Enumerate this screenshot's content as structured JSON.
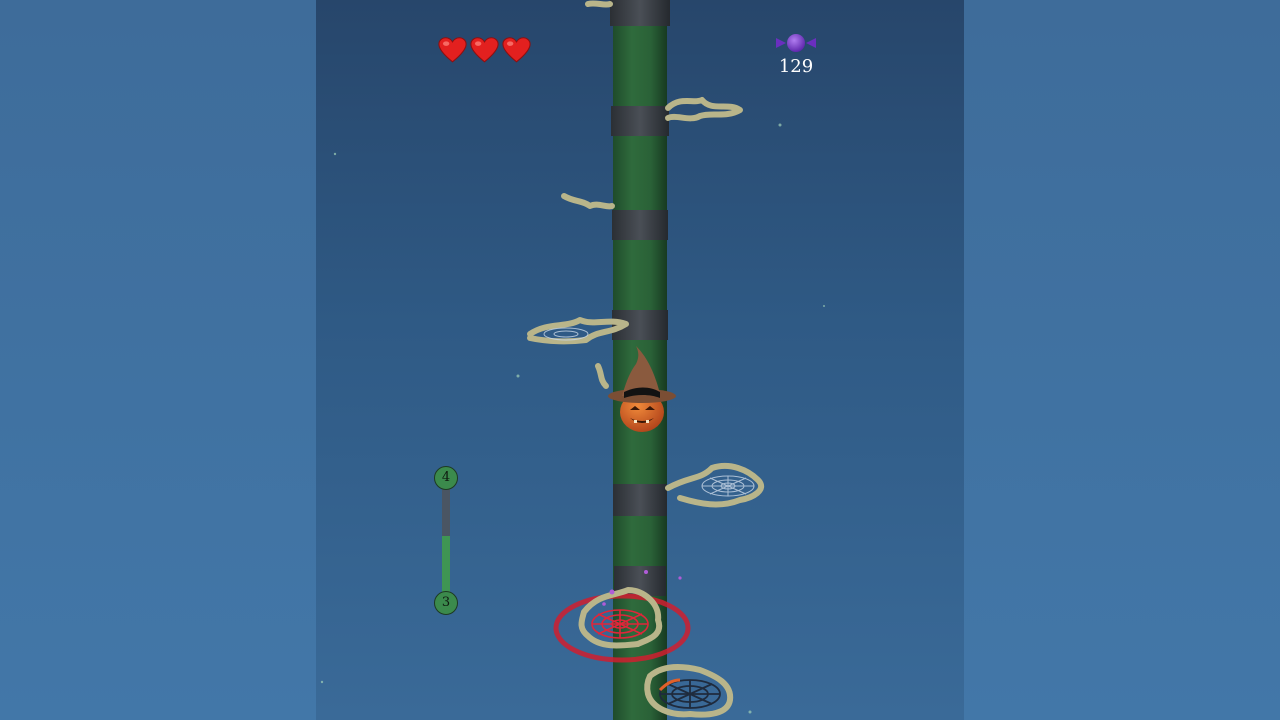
{
  "hud": {
    "lives": 3,
    "lives_max": 3,
    "candy_count": "129"
  },
  "level_progress": {
    "current_level": "3",
    "next_level": "4",
    "progress": 0.55
  },
  "colors": {
    "heart": "#e3201f",
    "candy": "#7b3fd0",
    "tower": "#2f6b3c",
    "tower_band": "#3d4249",
    "target_ring": "#d01f2f",
    "progress_fill": "#3f9553"
  },
  "icons": [
    "heart-icon",
    "candy-icon",
    "pumpkin-witch-character",
    "spider-web-platform"
  ]
}
